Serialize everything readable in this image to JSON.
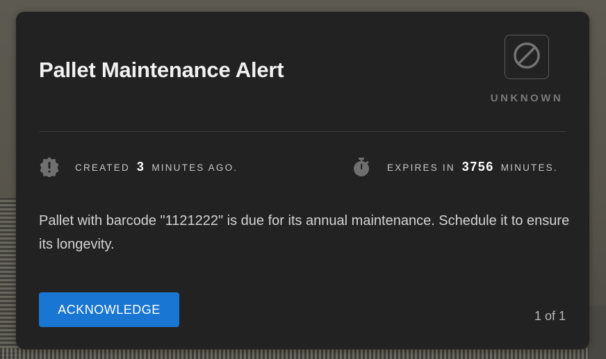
{
  "alert": {
    "title": "Pallet Maintenance Alert",
    "status": {
      "icon": "prohibited-icon",
      "label": "UNKNOWN"
    },
    "created": {
      "icon": "alert-badge-icon",
      "prefix": "CREATED",
      "value": "3",
      "suffix": "MINUTES AGO."
    },
    "expires": {
      "icon": "stopwatch-icon",
      "prefix": "EXPIRES IN",
      "value": "3756",
      "suffix": "MINUTES."
    },
    "message": "Pallet with barcode \"1121222\" is due for its annual maintenance. Schedule it to ensure its longevity.",
    "acknowledge_label": "ACKNOWLEDGE",
    "pager": "1 of 1"
  },
  "colors": {
    "card_bg": "#222222",
    "accent": "#1976d2",
    "muted": "#7a7a7a"
  }
}
